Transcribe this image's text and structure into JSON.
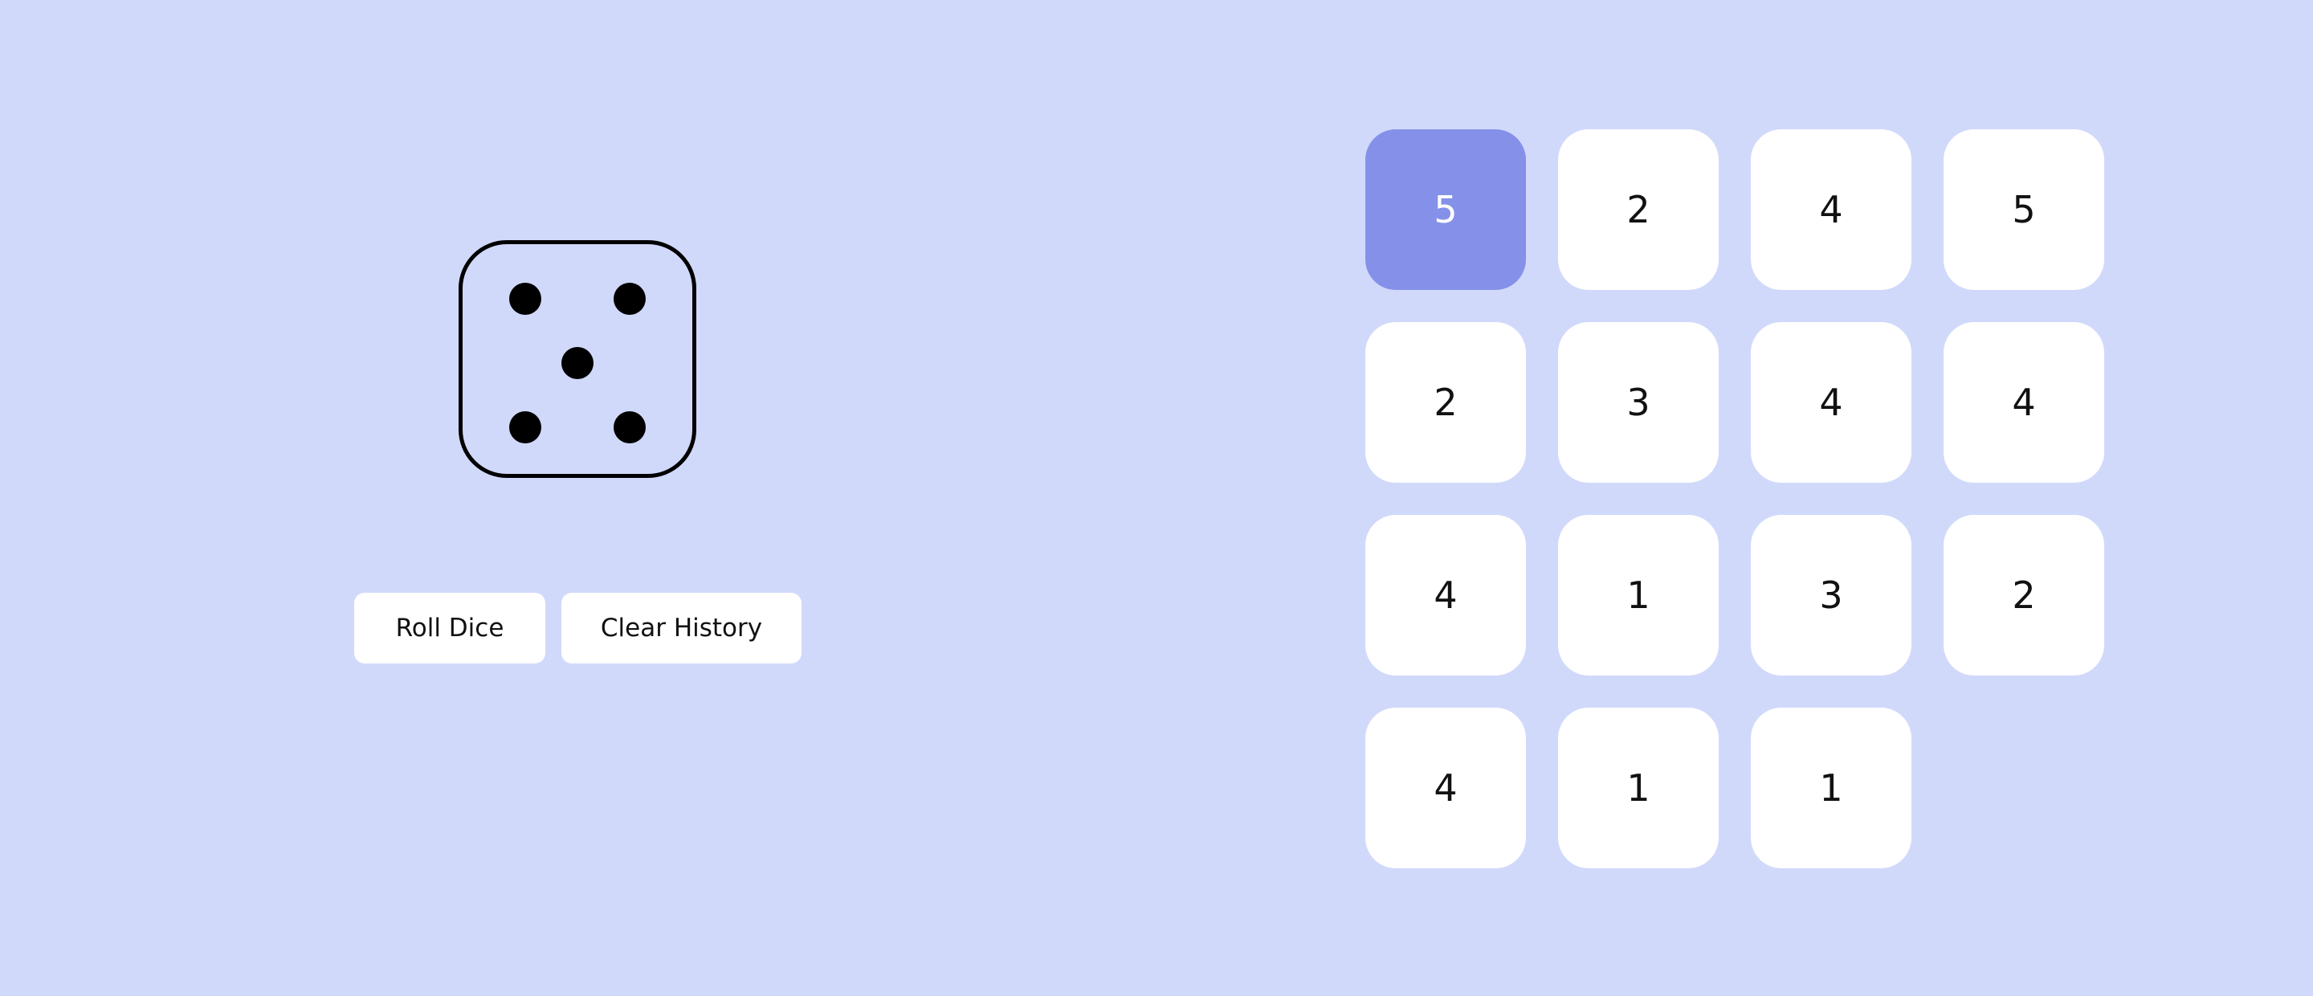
{
  "die": {
    "value": 5,
    "icon": "die-face-five-icon"
  },
  "controls": {
    "roll_label": "Roll Dice",
    "clear_label": "Clear History"
  },
  "history": {
    "rolls": [
      "5",
      "2",
      "4",
      "5",
      "2",
      "3",
      "4",
      "4",
      "4",
      "1",
      "3",
      "2",
      "4",
      "1",
      "1"
    ],
    "current_index": 0
  },
  "colors": {
    "background": "#d1d9fb",
    "highlight": "#8591e8",
    "card": "#ffffff"
  }
}
